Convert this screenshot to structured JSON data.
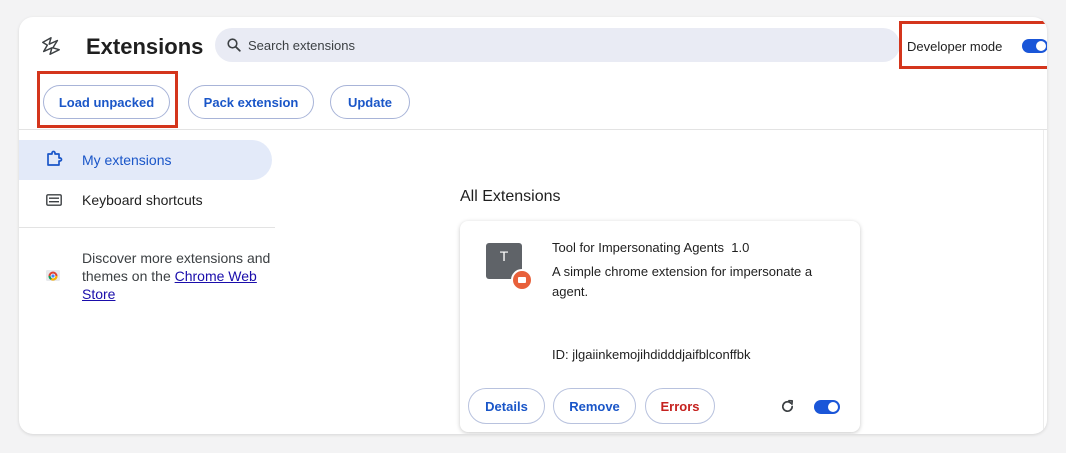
{
  "header": {
    "title": "Extensions",
    "search_placeholder": "Search extensions",
    "developer_mode_label": "Developer mode",
    "developer_mode_on": true
  },
  "toolbar": {
    "load_unpacked": "Load unpacked",
    "pack_extension": "Pack extension",
    "update": "Update"
  },
  "sidebar": {
    "items": [
      {
        "label": "My extensions",
        "icon": "puzzle-icon",
        "active": true
      },
      {
        "label": "Keyboard shortcuts",
        "icon": "keyboard-icon",
        "active": false
      }
    ],
    "discover_text": "Discover more extensions and themes on the ",
    "discover_link": "Chrome Web Store"
  },
  "main": {
    "section_title": "All Extensions",
    "extension": {
      "icon_letter": "T",
      "name": "Tool for Impersonating Agents",
      "version": "1.0",
      "description": "A simple chrome extension for impersonate a agent.",
      "id_text": "ID: jlgaiinkemojihdidddjaifblconffbk",
      "details_label": "Details",
      "remove_label": "Remove",
      "errors_label": "Errors",
      "enabled": true
    }
  },
  "colors": {
    "accent": "#1a56d8",
    "errors": "#c5221f",
    "highlight": "#d4351c"
  }
}
